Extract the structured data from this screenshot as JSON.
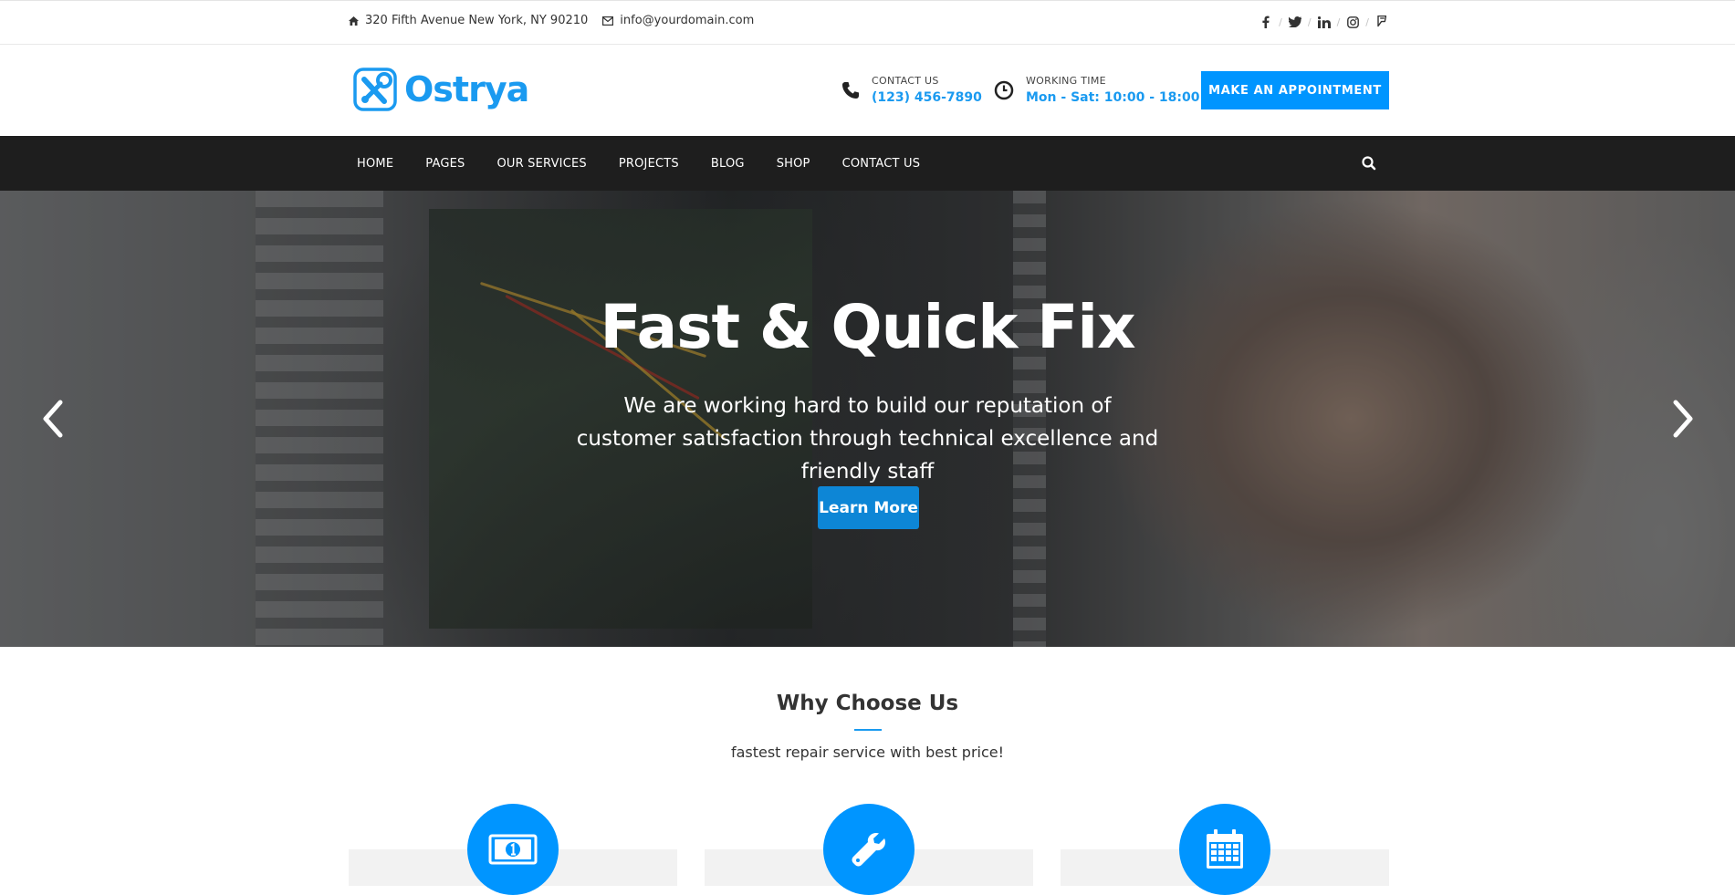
{
  "topbar": {
    "address": "320 Fifth Avenue New York, NY 90210",
    "email": "info@yourdomain.com",
    "socials": [
      "facebook-icon",
      "twitter-icon",
      "linkedin-icon",
      "instagram-icon",
      "foursquare-icon"
    ]
  },
  "header": {
    "logo_text": "Ostrya",
    "contact_label": "CONTACT US",
    "contact_value": "(123) 456-7890",
    "working_label": "WORKING TIME",
    "working_value": "Mon - Sat: 10:00 - 18:00",
    "appointment_button": "MAKE AN APPOINTMENT"
  },
  "nav": {
    "items": [
      "HOME",
      "PAGES",
      "OUR SERVICES",
      "PROJECTS",
      "BLOG",
      "SHOP",
      "CONTACT US"
    ]
  },
  "hero": {
    "title": "Fast & Quick Fix",
    "subtitle": "We are working hard to build our reputation of customer satisfaction through technical excellence and friendly staff",
    "button": "Learn More"
  },
  "why": {
    "title": "Why Choose Us",
    "subtitle": "fastest repair service with best price!",
    "features": [
      {
        "icon": "money-icon"
      },
      {
        "icon": "wrench-icon"
      },
      {
        "icon": "calendar-icon"
      }
    ]
  },
  "colors": {
    "accent": "#0095ff",
    "nav_bg": "#1e1e1e",
    "logo": "#1a9af0"
  }
}
